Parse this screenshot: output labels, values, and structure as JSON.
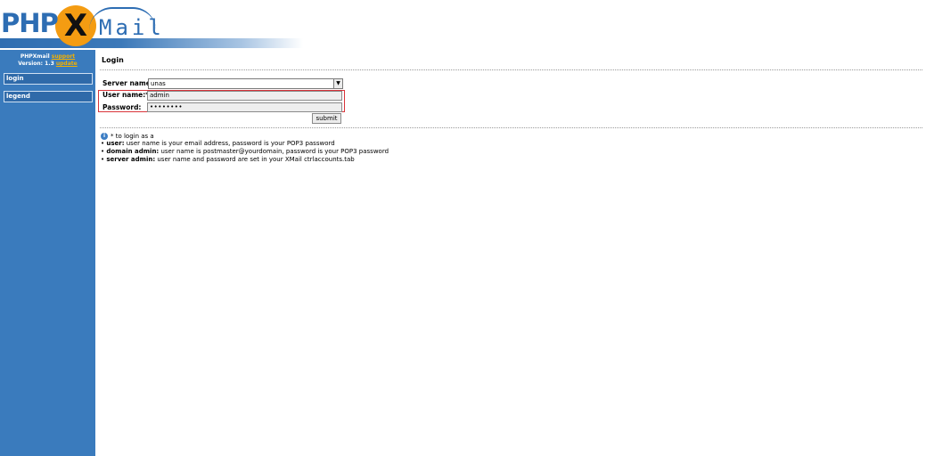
{
  "logo": {
    "part1": "PHP",
    "part2": "X",
    "part3": "Mail"
  },
  "sidebar": {
    "app_name": "PHPXmail",
    "support_link": "support",
    "version_text": "Version: 1.3",
    "update_link": "update",
    "nav": [
      {
        "label": "login"
      },
      {
        "label": "legend"
      }
    ]
  },
  "main": {
    "title": "Login",
    "form": {
      "server_label": "Server name:",
      "server_value": "unas",
      "user_label": "User name:*",
      "user_value": "admin",
      "password_label": "Password:",
      "password_value": "••••••••",
      "submit_label": "submit"
    },
    "legend": {
      "intro": "* to login as a",
      "roles": [
        {
          "name": "user:",
          "desc": " user name is your email address, password is your POP3 password"
        },
        {
          "name": "domain admin:",
          "desc": " user name is postmaster@yourdomain, password is your POP3 password"
        },
        {
          "name": "server admin:",
          "desc": " user name and password are set in your XMail ctrlaccounts.tab"
        }
      ]
    }
  },
  "colors": {
    "sidebar": "#3a7bbd",
    "accent": "#f49c12",
    "highlight": "#d9343a"
  }
}
